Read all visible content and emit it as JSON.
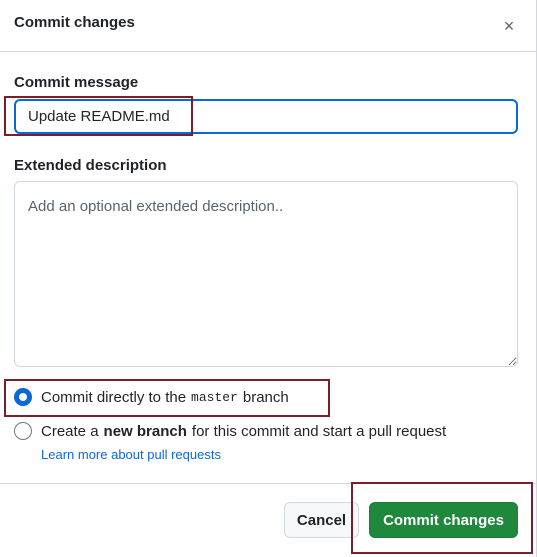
{
  "dialog": {
    "title": "Commit changes",
    "close_icon": "×"
  },
  "commit_message": {
    "label": "Commit message",
    "value": "Update README.md"
  },
  "extended_description": {
    "label": "Extended description",
    "placeholder": "Add an optional extended description.."
  },
  "options": {
    "direct": {
      "text_before": "Commit directly to the",
      "branch_name": "master",
      "text_after": "branch",
      "checked": true
    },
    "new_branch": {
      "text_before": "Create a",
      "bold": "new branch",
      "text_after": "for this commit and start a pull request",
      "checked": false
    },
    "learn_more": "Learn more about pull requests"
  },
  "footer": {
    "cancel_label": "Cancel",
    "commit_label": "Commit changes"
  },
  "colors": {
    "accent": "#0969da",
    "primary_button": "#1f883d",
    "annotation": "#7a1e2b"
  }
}
